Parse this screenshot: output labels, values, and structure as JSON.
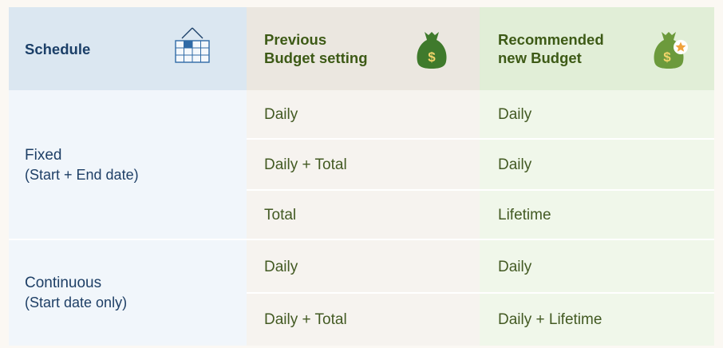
{
  "headers": {
    "schedule": "Schedule",
    "previous_line1": "Previous",
    "previous_line2": "Budget setting",
    "recommended_line1": "Recommended",
    "recommended_line2": "new Budget"
  },
  "icons": {
    "schedule": "calendar-icon",
    "previous": "money-bag-icon",
    "recommended": "money-bag-star-icon"
  },
  "groups": [
    {
      "schedule": "Fixed",
      "schedule_note": "(Start + End date)",
      "rows": [
        {
          "previous": "Daily",
          "recommended": "Daily"
        },
        {
          "previous": "Daily + Total",
          "recommended": "Daily"
        },
        {
          "previous": "Total",
          "recommended": "Lifetime"
        }
      ]
    },
    {
      "schedule": "Continuous",
      "schedule_note": "(Start date only)",
      "rows": [
        {
          "previous": "Daily",
          "recommended": "Daily"
        },
        {
          "previous": "Daily + Total",
          "recommended": "Daily + Lifetime"
        }
      ]
    }
  ],
  "colors": {
    "schedule_header_bg": "#dbe7f1",
    "previous_header_bg": "#ebe7e0",
    "recommended_header_bg": "#e1eed7",
    "money_bag_green": "#3f7a2c",
    "star_orange": "#f0a23c"
  }
}
